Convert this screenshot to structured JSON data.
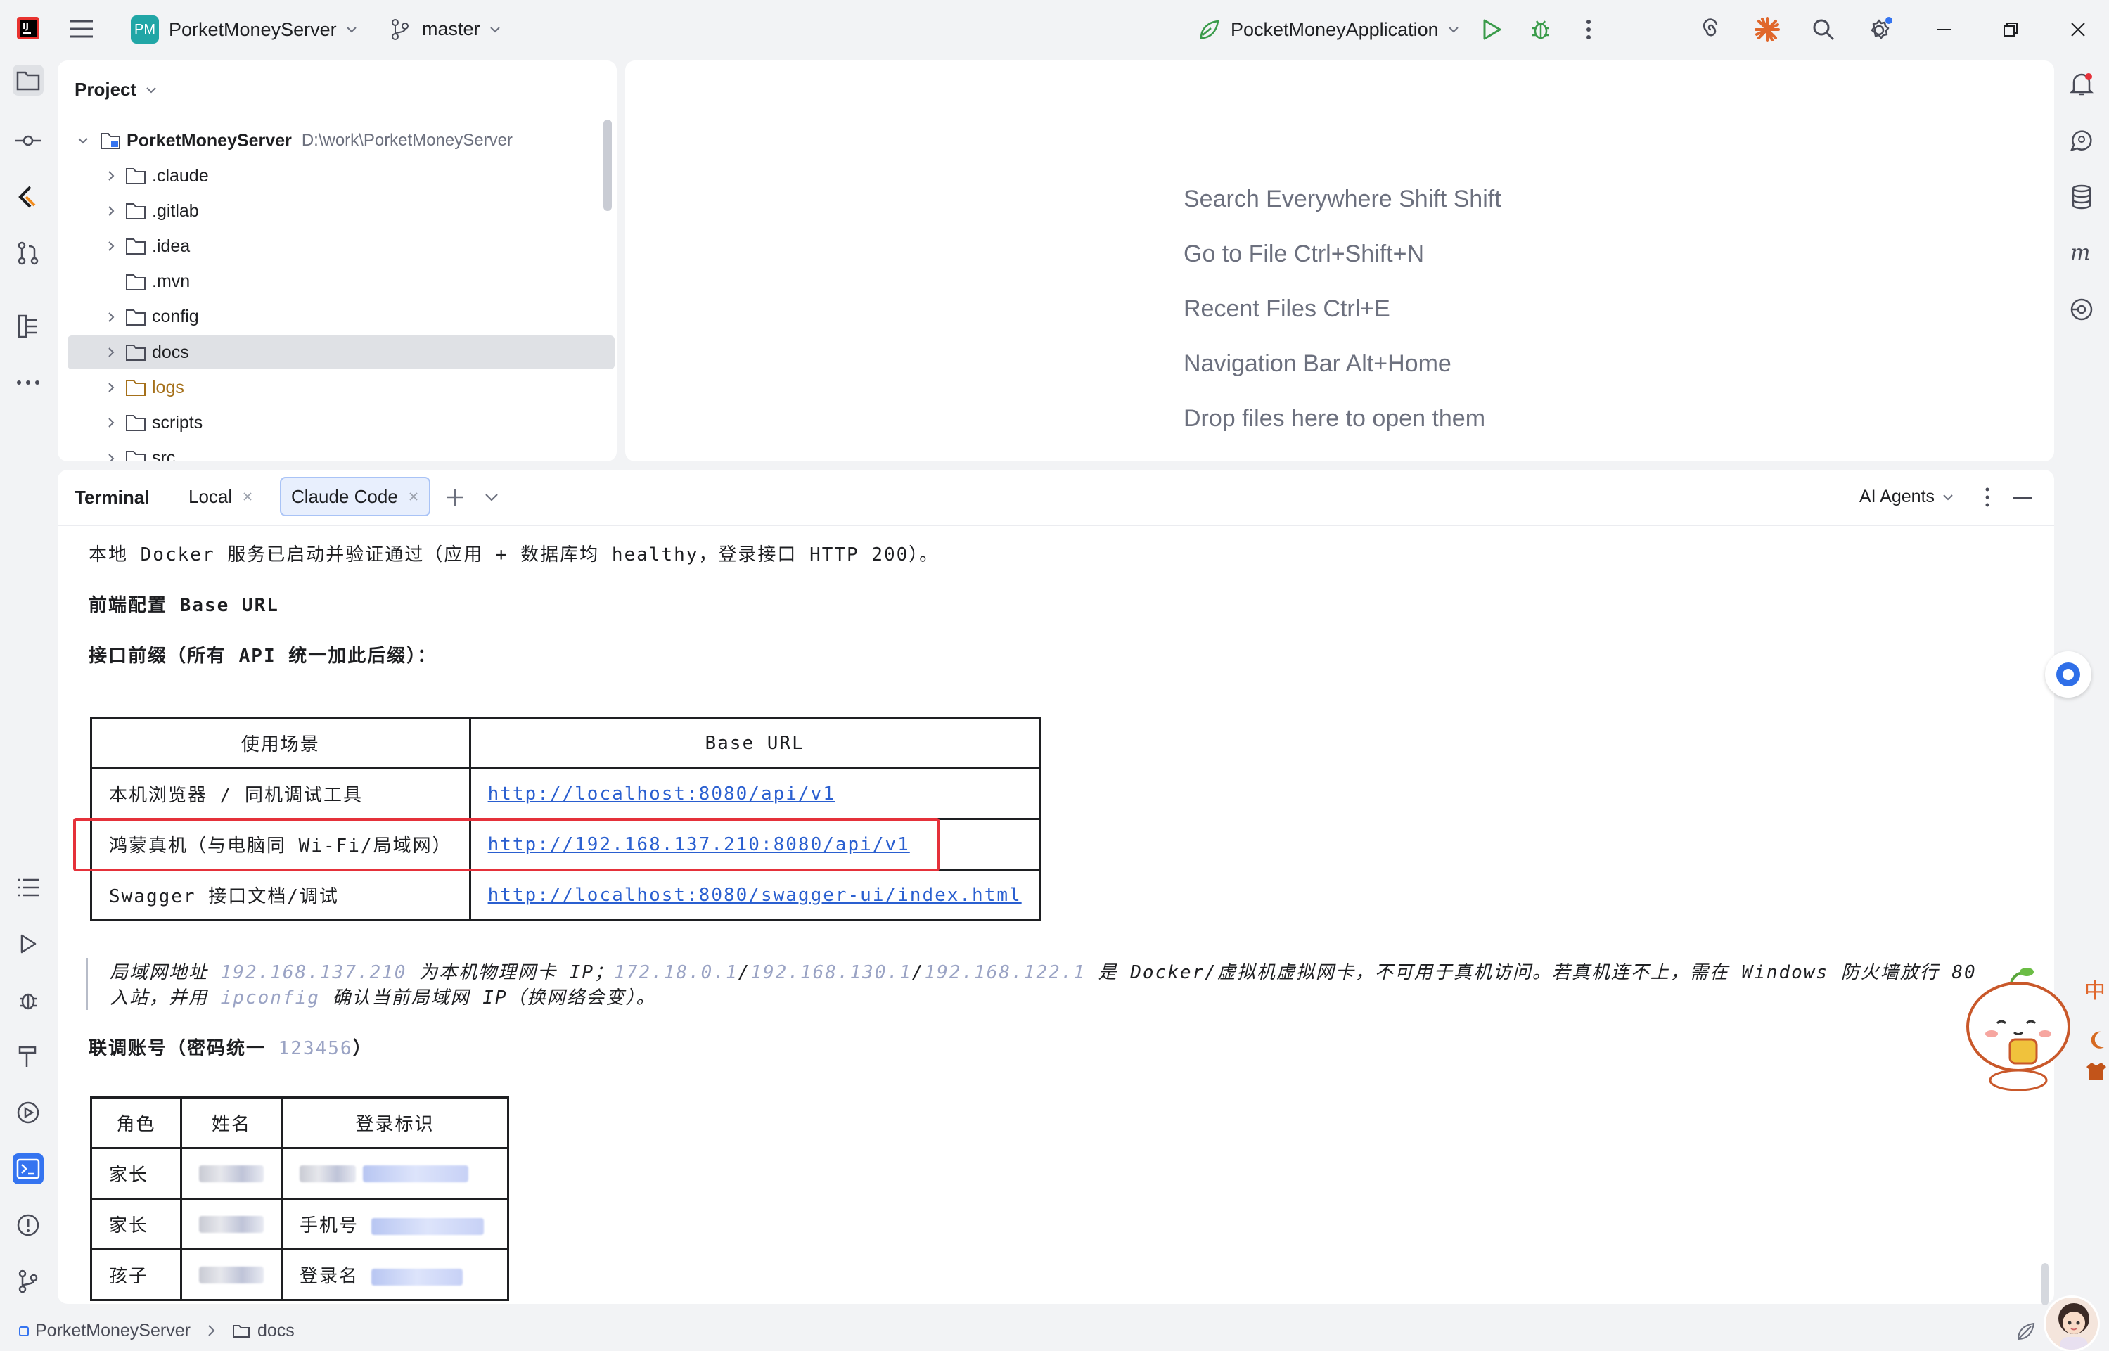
{
  "titlebar": {
    "project_badge": "PM",
    "project_name": "PorketMoneyServer",
    "branch": "master",
    "run_config": "PocketMoneyApplication"
  },
  "project_panel": {
    "title": "Project",
    "root": {
      "name": "PorketMoneyServer",
      "path": "D:\\work\\PorketMoneyServer"
    },
    "items": [
      {
        "label": ".claude"
      },
      {
        "label": ".gitlab"
      },
      {
        "label": ".idea"
      },
      {
        "label": ".mvn"
      },
      {
        "label": "config"
      },
      {
        "label": "docs"
      },
      {
        "label": "logs"
      },
      {
        "label": "scripts"
      },
      {
        "label": "src"
      }
    ]
  },
  "editor": {
    "hints": [
      "Search Everywhere Shift Shift",
      "Go to File Ctrl+Shift+N",
      "Recent Files Ctrl+E",
      "Navigation Bar Alt+Home",
      "Drop files here to open them"
    ]
  },
  "terminal": {
    "title": "Terminal",
    "tabs": [
      {
        "label": "Local"
      },
      {
        "label": "Claude Code"
      }
    ],
    "ai_agents": "AI Agents",
    "line1": "本地 Docker 服务已启动并验证通过（应用 + 数据库均 healthy，登录接口 HTTP 200）。",
    "heading1": "前端配置 Base URL",
    "heading2": "接口前缀（所有 API 统一加此后缀）：",
    "table1": {
      "headers": [
        "使用场景",
        "Base URL"
      ],
      "rows": [
        {
          "scene": "本机浏览器 / 同机调试工具",
          "url": "http://localhost:8080/api/v1"
        },
        {
          "scene": "鸿蒙真机（与电脑同 Wi-Fi/局域网）",
          "url": "http://192.168.137.210:8080/api/v1"
        },
        {
          "scene": "Swagger 接口文档/调试",
          "url": "http://localhost:8080/swagger-ui/index.html"
        }
      ]
    },
    "note": {
      "p1": "局域网地址 ",
      "ip1": "192.168.137.210",
      "p2": " 为本机物理网卡 IP；",
      "ip2": "172.18.0.1",
      "sep1": "/",
      "ip3": "192.168.130.1",
      "sep2": "/",
      "ip4": "192.168.122.1",
      "p3": " 是 Docker/虚拟机虚拟网卡，不可用于真机访问。若真机连不上，需在 Windows 防火墙放行 ",
      "port": "80",
      "line2a": "入站，并用 ",
      "cmd": "ipconfig",
      "line2b": " 确认当前局域网 IP（换网络会变）。"
    },
    "heading3": "联调账号（密码统一 ",
    "password": "123456",
    "heading3_end": "）",
    "table2": {
      "headers": [
        "角色",
        "姓名",
        "登录标识"
      ],
      "rows": [
        {
          "role": "家长",
          "id_label": ""
        },
        {
          "role": "家长",
          "id_label": "手机号"
        },
        {
          "role": "孩子",
          "id_label": "登录名"
        }
      ]
    }
  },
  "statusbar": {
    "project": "PorketMoneyServer",
    "folder": "docs"
  },
  "ime": {
    "label": "中"
  },
  "colors": {
    "accent": "#3574f0",
    "highlight_box": "#e5313a",
    "link": "#2a5fd0",
    "dim_text": "#9aa3c4"
  }
}
